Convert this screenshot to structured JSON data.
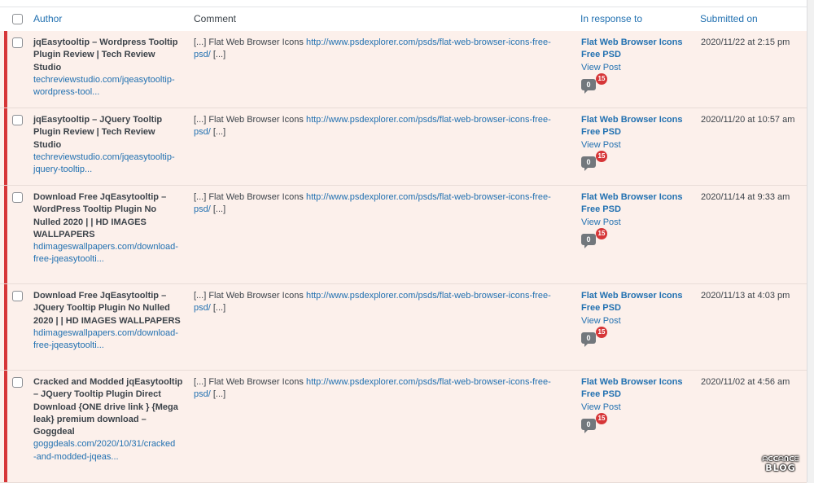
{
  "header": {
    "author": "Author",
    "comment": "Comment",
    "in_response_to": "In response to",
    "submitted_on": "Submitted on"
  },
  "rows": [
    {
      "author_lines": [
        "jqEasytooltip – Wordpress Tooltip",
        "Plugin Review | Tech Review Studio"
      ],
      "url_lines": [
        "techreviewstudio.com/jqeasytooltip-",
        "wordpress-tool..."
      ],
      "comment_prefix": "[...] Flat Web Browser Icons ",
      "comment_link": "http://www.psdexplorer.com/psds/flat-web-browser-icons-free-",
      "comment_link2": "psd/",
      "comment_suffix": " [...]",
      "post_lines": [
        "Flat Web Browser Icons",
        "Free PSD"
      ],
      "view_post": "View Post",
      "approved": "0",
      "pending": "15",
      "submitted": "2020/11/22 at 2:15 pm"
    },
    {
      "author_lines": [
        "jqEasytooltip – JQuery Tooltip",
        "Plugin Review | Tech Review Studio"
      ],
      "url_lines": [
        "techreviewstudio.com/jqeasytooltip-",
        "jquery-tooltip..."
      ],
      "comment_prefix": "[...] Flat Web Browser Icons ",
      "comment_link": "http://www.psdexplorer.com/psds/flat-web-browser-icons-free-",
      "comment_link2": "psd/",
      "comment_suffix": " [...]",
      "post_lines": [
        "Flat Web Browser Icons",
        "Free PSD"
      ],
      "view_post": "View Post",
      "approved": "0",
      "pending": "15",
      "submitted": "2020/11/20 at 10:57 am"
    },
    {
      "author_lines": [
        "Download Free JqEasytooltip –",
        "WordPress Tooltip Plugin No",
        "Nulled 2020 | | HD IMAGES",
        "WALLPAPERS"
      ],
      "url_lines": [
        "hdimageswallpapers.com/download-",
        "free-jqeasytoolti..."
      ],
      "comment_prefix": "[...] Flat Web Browser Icons ",
      "comment_link": "http://www.psdexplorer.com/psds/flat-web-browser-icons-free-",
      "comment_link2": "psd/",
      "comment_suffix": " [...]",
      "post_lines": [
        "Flat Web Browser Icons",
        "Free PSD"
      ],
      "view_post": "View Post",
      "approved": "0",
      "pending": "15",
      "submitted": "2020/11/14 at 9:33 am"
    },
    {
      "author_lines": [
        "Download Free JqEasytooltip –",
        "JQuery Tooltip Plugin No Nulled",
        "2020 | | HD IMAGES WALLPAPERS"
      ],
      "url_lines": [
        "hdimageswallpapers.com/download-",
        "free-jqeasytoolti..."
      ],
      "comment_prefix": "[...] Flat Web Browser Icons ",
      "comment_link": "http://www.psdexplorer.com/psds/flat-web-browser-icons-free-",
      "comment_link2": "psd/",
      "comment_suffix": " [...]",
      "post_lines": [
        "Flat Web Browser Icons",
        "Free PSD"
      ],
      "view_post": "View Post",
      "approved": "0",
      "pending": "15",
      "submitted": "2020/11/13 at 4:03 pm"
    },
    {
      "author_lines": [
        "Cracked and Modded jqEasytooltip",
        "– JQuery Tooltip Plugin Direct",
        "Download {ONE drive link } {Mega",
        "leak} premium download –",
        "Goggdeal"
      ],
      "url_lines": [
        "goggdeals.com/2020/10/31/cracked",
        "-and-modded-jqeas..."
      ],
      "comment_prefix": "[...] Flat Web Browser Icons ",
      "comment_link": "http://www.psdexplorer.com/psds/flat-web-browser-icons-free-",
      "comment_link2": "psd/",
      "comment_suffix": " [...]",
      "post_lines": [
        "Flat Web Browser Icons",
        "Free PSD"
      ],
      "view_post": "View Post",
      "approved": "0",
      "pending": "15",
      "submitted": "2020/11/02 at 4:56 am"
    }
  ],
  "watermark": {
    "line1": "ᗩᑕᑕᗩᑎᑕᗴ",
    "line2": "BLOG"
  },
  "colors": {
    "link": "#2271b1",
    "unapproved_bg": "#fcf0eb",
    "unapproved_bar": "#d63638"
  }
}
